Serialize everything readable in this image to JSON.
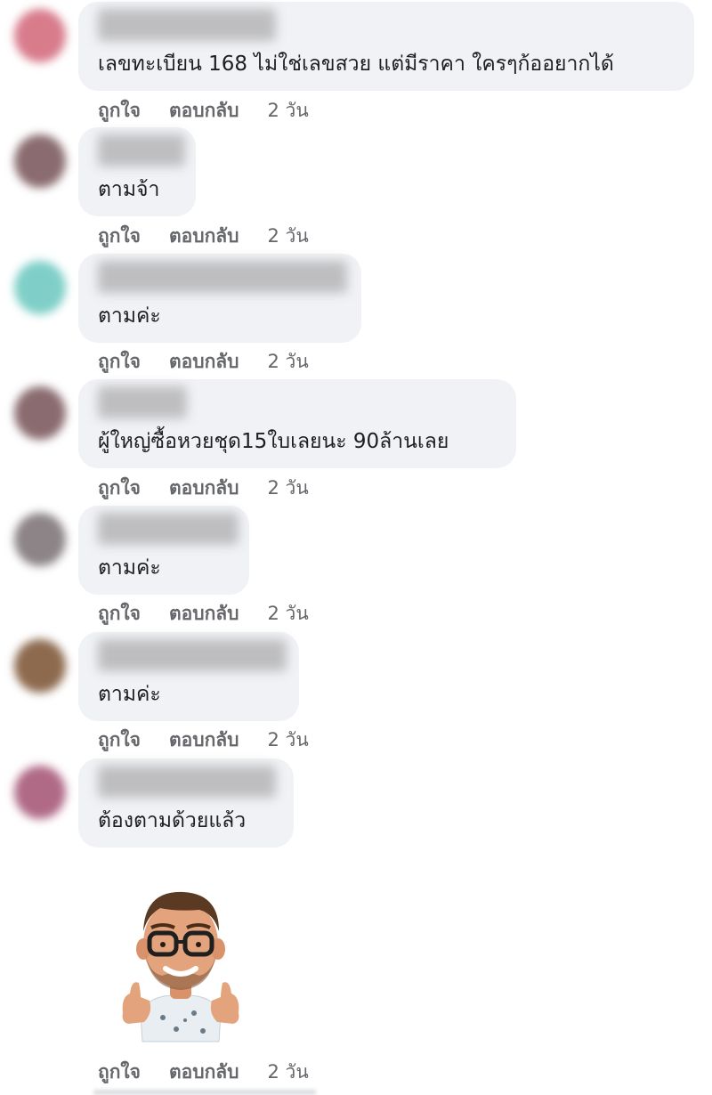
{
  "comments": [
    {
      "text": "เลขทะเบียน 168 ไม่ใช่เลขสวย แต่มีราคา ใครๆก้ออยากได้",
      "avatar_color": "#d87c8c"
    },
    {
      "text": "ตามจ้า",
      "avatar_color": "#8a6c70"
    },
    {
      "text": "ตามค่ะ",
      "avatar_color": "#7fcfc8"
    },
    {
      "text": "ผู้ใหญ่ซื้อหวยชุด15ใบเลยนะ 90ล้านเลย",
      "avatar_color": "#8a6c70"
    },
    {
      "text": "ตามค่ะ",
      "avatar_color": "#8c8486"
    },
    {
      "text": "ตามค่ะ",
      "avatar_color": "#8d6a4e"
    },
    {
      "text": "ต้องตามด้วยแล้ว",
      "avatar_color": "#b06a86"
    }
  ],
  "actions": {
    "like": "ถูกใจ",
    "reply": "ตอบกลับ",
    "time": "2 วัน"
  },
  "sticker": {
    "icon": "memoji-thumbs-up-sticker"
  }
}
